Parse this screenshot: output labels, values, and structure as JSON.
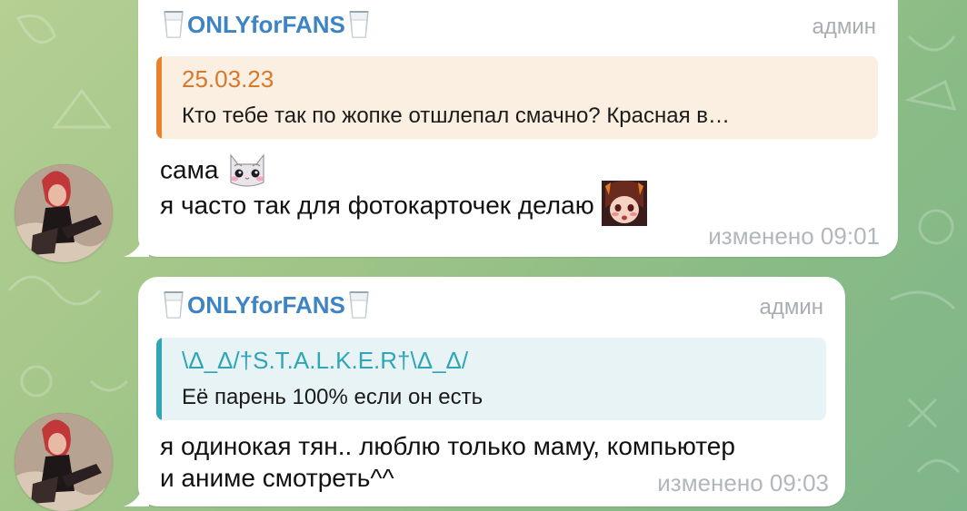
{
  "messages": [
    {
      "sender": "ONLYforFANS",
      "role": "админ",
      "reply": {
        "author": "25.03.23",
        "text": "Кто тебе так по жопке отшлепал смачно? Красная в…",
        "accent": "#e8822a"
      },
      "lines": [
        "сама",
        "я часто так для фотокарточек делаю"
      ],
      "edited": "изменено",
      "time": "09:01"
    },
    {
      "sender": "ONLYforFANS",
      "role": "админ",
      "reply": {
        "author": "\\Δ_Δ/†S.T.A.L.K.E.R†\\Δ_Δ/",
        "text": "Её парень 100% если он есть",
        "accent": "#2fa6b5"
      },
      "lines": [
        "я одинокая тян.. люблю только маму, компьютер",
        "и аниме смотреть^^"
      ],
      "edited": "изменено",
      "time": "09:03"
    }
  ],
  "icons": {
    "sender_emoji": "milk-glass-icon",
    "sticker_1": "cat-face-emoji",
    "sticker_2": "anime-face-emoji"
  }
}
